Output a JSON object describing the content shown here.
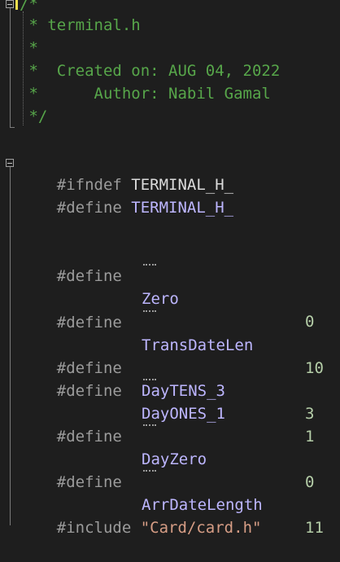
{
  "editor": {
    "comment_block": [
      "/*",
      " * terminal.h",
      " *",
      " *  Created on: AUG 04, 2022",
      " *      Author: Nabil Gamal",
      " */"
    ],
    "ifndef": {
      "directive": "#ifndef",
      "name": "TERMINAL_H_"
    },
    "define_guard": {
      "directive": "#define",
      "name": "TERMINAL_H_"
    },
    "defines": [
      {
        "directive": "#define",
        "name": "Zero",
        "value": "0"
      },
      {
        "directive": "#define",
        "name": "TransDateLen",
        "value": "10"
      },
      {
        "directive": "#define",
        "name": "DayTENS_3",
        "value": "3"
      },
      {
        "directive": "#define",
        "name": "DayONES_1",
        "value": "1"
      },
      {
        "directive": "#define",
        "name": "DayZero",
        "value": "0"
      },
      {
        "directive": "#define",
        "name": "ArrDateLength",
        "value": "11"
      }
    ],
    "include": {
      "directive": "#include",
      "path": "\"Card/card.h\""
    }
  },
  "colors": {
    "background": "#1e1e1e",
    "comment": "#57a64a",
    "preprocessor": "#9b9b9b",
    "macro_name": "#bdb6ff",
    "number": "#b5cea8",
    "string": "#d69d85"
  }
}
